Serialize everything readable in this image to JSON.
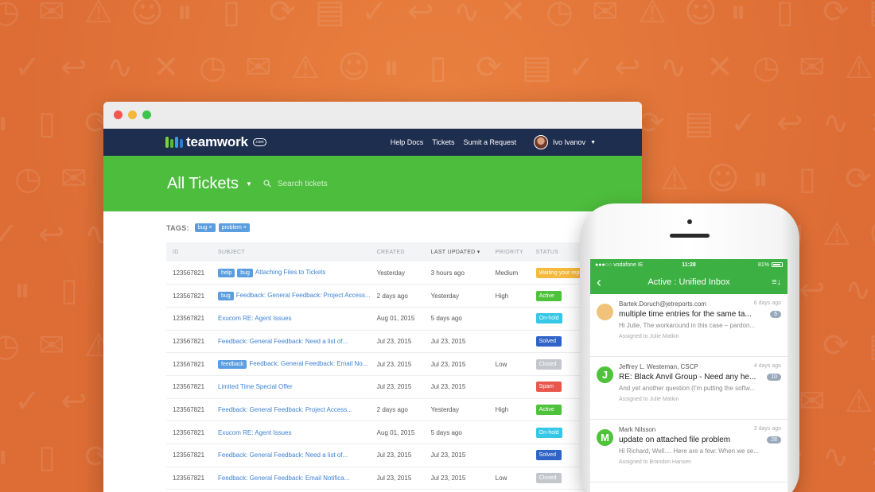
{
  "colors": {
    "background": "#e0733c",
    "nav": "#1e2e4f",
    "hero": "#4dbd3d",
    "link": "#3f83d4",
    "tag": "#5b9ee0",
    "mobile_green": "#3cb043"
  },
  "background_icons": [
    "clock-icon",
    "envelope-icon",
    "warning-icon",
    "user-icon",
    "pause-icon",
    "trash-icon",
    "refresh-icon",
    "document-icon",
    "check-icon",
    "reply-icon",
    "pulse-icon",
    "close-icon"
  ],
  "browser": {
    "nav": {
      "logo_text": "teamwork",
      "logo_suffix": ".com",
      "links": [
        "Help Docs",
        "Tickets",
        "Sumit a Request"
      ],
      "user_name": "Ivo Ivanov"
    },
    "hero": {
      "title": "All Tickets",
      "search_placeholder": "Search tickets"
    },
    "tags": {
      "label": "TAGS:",
      "items": [
        "bug ×",
        "problem ×"
      ]
    },
    "table": {
      "columns": [
        "ID",
        "SUBJECT",
        "CREATED",
        "LAST UPDATED",
        "PRIORITY",
        "STATUS"
      ],
      "sorted_marker": "▾",
      "rows": [
        {
          "id": "123567821",
          "labels": [
            "help",
            "bug"
          ],
          "subject": "Attaching Files to Tickets",
          "created": "Yesterday",
          "updated": "3 hours ago",
          "priority": "Medium",
          "status": "Waiting your repl",
          "status_color": "#f5b93e"
        },
        {
          "id": "123567821",
          "labels": [
            "bug"
          ],
          "subject": "Feedback: General Feedback: Project Access...",
          "created": "2 days ago",
          "updated": "Yesterday",
          "priority": "High",
          "status": "Active",
          "status_color": "#4fc23c"
        },
        {
          "id": "123567821",
          "labels": [],
          "subject": "Exucom RE: Agent Issues",
          "created": "Aug 01, 2015",
          "updated": "5 days ago",
          "priority": "",
          "status": "On-hold",
          "status_color": "#35c7e6"
        },
        {
          "id": "123567821",
          "labels": [],
          "subject": "Feedback: General Feedback: Need a list of...",
          "created": "Jul 23, 2015",
          "updated": "Jul 23, 2015",
          "priority": "",
          "status": "Solved",
          "status_color": "#2f63c8"
        },
        {
          "id": "123567821",
          "labels": [
            "feedback"
          ],
          "subject": "Feedback: General Feedback: Email No...",
          "created": "Jul 23, 2015",
          "updated": "Jul 23, 2015",
          "priority": "Low",
          "status": "Closed",
          "status_color": "#c3c7cc"
        },
        {
          "id": "123567821",
          "labels": [],
          "subject": "Limited Time Special Offer",
          "created": "Jul 23, 2015",
          "updated": "Jul 23, 2015",
          "priority": "",
          "status": "Spam",
          "status_color": "#e8574c"
        },
        {
          "id": "123567821",
          "labels": [],
          "subject": "Feedback: General Feedback: Project Access...",
          "created": "2 days ago",
          "updated": "Yesterday",
          "priority": "High",
          "status": "Active",
          "status_color": "#4fc23c"
        },
        {
          "id": "123567821",
          "labels": [],
          "subject": "Exucom RE: Agent Issues",
          "created": "Aug 01, 2015",
          "updated": "5 days ago",
          "priority": "",
          "status": "On-hold",
          "status_color": "#35c7e6"
        },
        {
          "id": "123567821",
          "labels": [],
          "subject": "Feedback: General Feedback: Need a list of...",
          "created": "Jul 23, 2015",
          "updated": "Jul 23, 2015",
          "priority": "",
          "status": "Solved",
          "status_color": "#2f63c8"
        },
        {
          "id": "123567821",
          "labels": [],
          "subject": "Feedback: General Feedback: Email Notifica...",
          "created": "Jul 23, 2015",
          "updated": "Jul 23, 2015",
          "priority": "Low",
          "status": "Closed",
          "status_color": "#c3c7cc"
        }
      ]
    }
  },
  "phone": {
    "carrier": "●●●○○ vodafone IE",
    "time": "11:28",
    "battery": "81%",
    "title": "Active : Unified Inbox",
    "messages": [
      {
        "avatar": "",
        "avatar_color": "#f1c27a",
        "from": "Bartek.Doruch@jetreports.com",
        "when": "6 days ago",
        "subject": "multiple time entries  for the same ta...",
        "count": "5",
        "preview": "Hi Julie, The workaround in this case – pardon...",
        "assigned": "Assigned to Julie Matkin"
      },
      {
        "avatar": "J",
        "avatar_color": "#4fc23c",
        "from": "Jeffrey L. Westeman, CSCP",
        "when": "4 days ago",
        "subject": "RE: Black Anvil Group - Need any he...",
        "count": "10",
        "preview": "And yet another question (I'm putting the softw...",
        "assigned": "Assigned to Julie Matkin"
      },
      {
        "avatar": "M",
        "avatar_color": "#4fc23c",
        "from": "Mark Nilsson",
        "when": "3 days ago",
        "subject": "update on attached file problem",
        "count": "28",
        "preview": "Hi Richard, Well.... Here are a few: When we se...",
        "assigned": "Assigned to Brandon Hansen"
      }
    ]
  }
}
